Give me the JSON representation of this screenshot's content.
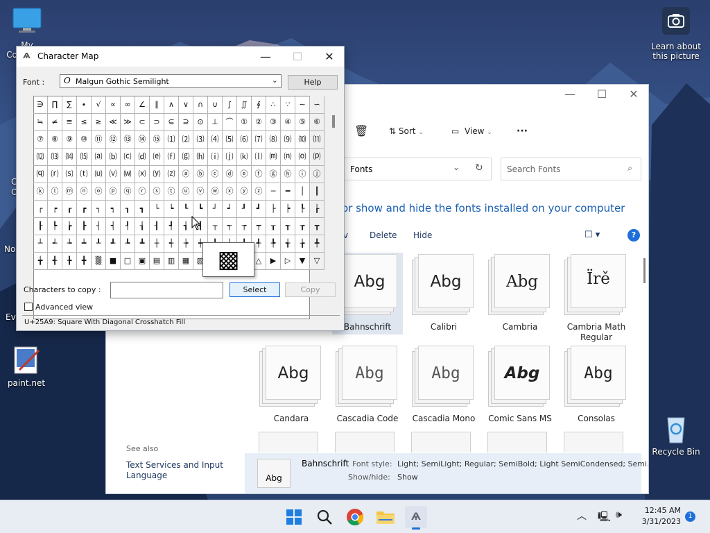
{
  "desktop": {
    "icons": [
      {
        "label": "My Computer"
      },
      {
        "label": "paint.net"
      },
      {
        "label": "Recycle Bin"
      },
      {
        "label": "Learn about this picture"
      }
    ],
    "partial_labels": [
      "No",
      "Ev",
      "C",
      "O"
    ]
  },
  "charmap": {
    "title": "Character Map",
    "font_label": "Font :",
    "font_value": "Malgun Gothic Semilight",
    "help_label": "Help",
    "chars_label": "Characters to copy :",
    "chars_value": "",
    "select_label": "Select",
    "copy_label": "Copy",
    "advanced_label": "Advanced view",
    "advanced_checked": false,
    "status": "U+25A9: Square With Diagonal Crosshatch Fill",
    "zoom_char": "▩",
    "rows": [
      [
        "∋",
        "∏",
        "∑",
        "∙",
        "√",
        "∝",
        "∞",
        "∠",
        "∥",
        "∧",
        "∨",
        "∩",
        "∪",
        "∫",
        "∬",
        "∮",
        "∴",
        "∵",
        "∼",
        "∽"
      ],
      [
        "≒",
        "≠",
        "≡",
        "≤",
        "≥",
        "≪",
        "≫",
        "⊂",
        "⊃",
        "⊆",
        "⊇",
        "⊙",
        "⊥",
        "⌒",
        "①",
        "②",
        "③",
        "④",
        "⑤",
        "⑥"
      ],
      [
        "⑦",
        "⑧",
        "⑨",
        "⑩",
        "⑪",
        "⑫",
        "⑬",
        "⑭",
        "⑮",
        "⑴",
        "⑵",
        "⑶",
        "⑷",
        "⑸",
        "⑹",
        "⑺",
        "⑻",
        "⑼",
        "⑽",
        "⑾"
      ],
      [
        "⑿",
        "⒀",
        "⒁",
        "⒂",
        "⒜",
        "⒝",
        "⒞",
        "⒟",
        "⒠",
        "⒡",
        "⒢",
        "⒣",
        "⒤",
        "⒥",
        "⒦",
        "⒧",
        "⒨",
        "⒩",
        "⒪",
        "⒫"
      ],
      [
        "⒬",
        "⒭",
        "⒮",
        "⒯",
        "⒰",
        "⒱",
        "⒲",
        "⒳",
        "⒴",
        "⒵",
        "ⓐ",
        "ⓑ",
        "ⓒ",
        "ⓓ",
        "ⓔ",
        "ⓕ",
        "ⓖ",
        "ⓗ",
        "ⓘ",
        "ⓙ"
      ],
      [
        "ⓚ",
        "ⓛ",
        "ⓜ",
        "ⓝ",
        "ⓞ",
        "ⓟ",
        "ⓠ",
        "ⓡ",
        "ⓢ",
        "ⓣ",
        "ⓤ",
        "ⓥ",
        "ⓦ",
        "ⓧ",
        "ⓨ",
        "ⓩ",
        "─",
        "━",
        "│",
        "┃"
      ],
      [
        "┌",
        "┍",
        "┎",
        "┏",
        "┐",
        "┑",
        "┒",
        "┓",
        "└",
        "┕",
        "┖",
        "┗",
        "┘",
        "┙",
        "┚",
        "┛",
        "├",
        "┝",
        "┞",
        "┟"
      ],
      [
        "┠",
        "┡",
        "┢",
        "┣",
        "┤",
        "┥",
        "┦",
        "┧",
        "┨",
        "┩",
        "┪",
        "┫",
        "┬",
        "┭",
        "┮",
        "┯",
        "┰",
        "┱",
        "┲",
        "┳"
      ],
      [
        "┴",
        "┵",
        "┶",
        "┷",
        "┸",
        "┹",
        "┺",
        "┻",
        "┼",
        "┽",
        "┾",
        "┿",
        "╀",
        "╁",
        "╂",
        "╃",
        "╄",
        "╅",
        "╆",
        "╇"
      ],
      [
        "╈",
        "╉",
        "╊",
        "╋",
        "▒",
        "■",
        "□",
        "▣",
        "▤",
        "▥",
        "▦",
        "▧",
        "▨",
        "▩",
        "▲",
        "△",
        "▶",
        "▷",
        "▼",
        "▽"
      ]
    ]
  },
  "explorer": {
    "toolbar": {
      "sort": "Sort",
      "view": "View",
      "more": "···"
    },
    "address": "Fonts",
    "search_placeholder": "Search Fonts",
    "heading": "or show and hide the fonts installed on your computer",
    "commands": {
      "partial": "v",
      "delete": "Delete",
      "hide": "Hide"
    },
    "sidebar": {
      "see_also": "See also",
      "link": "Text Services and Input Language"
    },
    "fonts": [
      {
        "name": "Bahnschrift",
        "sample": "Abg",
        "selected": true
      },
      {
        "name": "Calibri",
        "sample": "Abg"
      },
      {
        "name": "Cambria",
        "sample": "Abg"
      },
      {
        "name": "Cambria Math Regular",
        "sample": "Ïrě"
      },
      {
        "name": "Candara",
        "sample": "Abg"
      },
      {
        "name": "Cascadia Code",
        "sample": "Abg"
      },
      {
        "name": "Cascadia Mono",
        "sample": "Abg"
      },
      {
        "name": "Comic Sans MS",
        "sample": "Abg"
      },
      {
        "name": "Consolas",
        "sample": "Abg"
      }
    ],
    "details": {
      "name": "Bahnschrift",
      "sample": "Abg",
      "style_label": "Font style:",
      "style_value": "Light; SemiLight; Regular; SemiBold; Light SemiCondensed; Semi...",
      "showhide_label": "Show/hide:",
      "showhide_value": "Show"
    }
  },
  "taskbar": {
    "time": "12:45 AM",
    "date": "3/31/2023",
    "badge": "1"
  }
}
